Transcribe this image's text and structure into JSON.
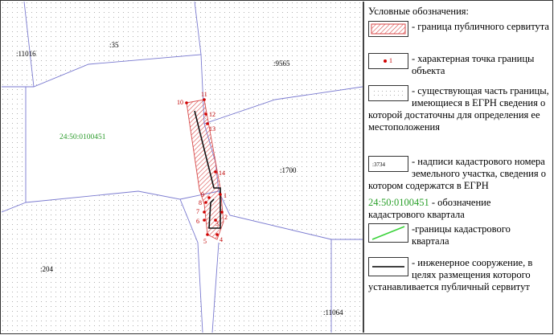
{
  "map": {
    "parcel_labels": [
      ":11016",
      ":35",
      ":9565",
      ":1700",
      ":204",
      ":11064"
    ],
    "quarter_label": "24:50:0100451",
    "point_numbers": [
      "10",
      "11",
      "12",
      "13",
      "14",
      "1",
      "9",
      "8",
      "7",
      "6",
      "2",
      "3",
      "5",
      "4"
    ]
  },
  "legend": {
    "title": "Условные обозначения:",
    "items": [
      {
        "symbol": "hatch-icon",
        "text": "- граница публичного сервитута"
      },
      {
        "symbol": "point-icon",
        "text": "- характерная точка границы объекта",
        "sample": "1"
      },
      {
        "symbol": "dotted-area-icon",
        "text": "- существующая часть границы, имеющиеся в ЕГРН сведения о которой достаточны для определения ее местоположения"
      },
      {
        "symbol": "cadastral-number-icon",
        "text": "- надписи кадастрового номера земельного участка, сведения о котором содержатся в ЕГРН",
        "sample": ":3734"
      },
      {
        "symbol": "quarter-label",
        "code": "24:50:0100451",
        "text": "- обозначение кадастрового квартала"
      },
      {
        "symbol": "green-line-icon",
        "text": "-границы кадастрового квартала"
      },
      {
        "symbol": "black-line-icon",
        "text": "- инженерное сооружение, в целях размещения которого устанавливается публичный сервитут"
      }
    ]
  },
  "colors": {
    "hatch": "#d84a4a",
    "point": "#d00000",
    "parcel_border": "#7a7ad0",
    "quarter_text": "#2aa02a",
    "green_line": "#3ad23a",
    "dots": "#9a9a9a"
  }
}
